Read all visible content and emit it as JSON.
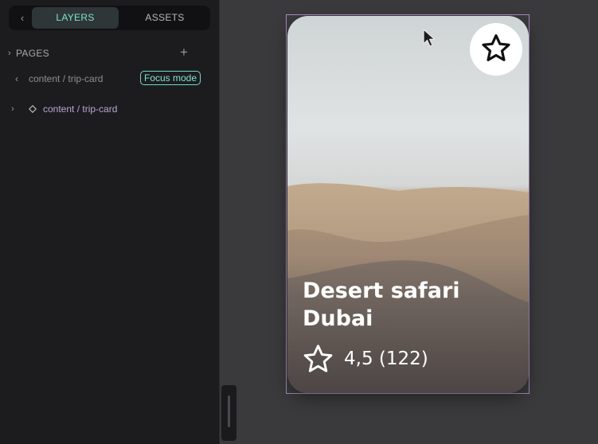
{
  "sidebar": {
    "tabs": {
      "back_glyph": "‹",
      "layers": "LAYERS",
      "assets": "ASSETS"
    },
    "pages": {
      "chevron": "›",
      "label": "PAGES",
      "add_glyph": "+"
    },
    "focus": {
      "back_glyph": "‹",
      "path": "content / trip-card",
      "badge": "Focus mode"
    },
    "layers": [
      {
        "chevron": "›",
        "icon": "diamond-component-icon",
        "name": "content / trip-card"
      }
    ]
  },
  "card": {
    "title_line1": "Desert safari",
    "title_line2": "Dubai",
    "rating": "4,5 (122)",
    "favorite_icon": "star-outline-icon",
    "rating_icon": "star-outline-icon"
  },
  "colors": {
    "accent_teal": "#7fe3d6",
    "component_purple": "#b9a4d6",
    "selection_border": "#a78bc0",
    "sidebar_bg": "#1c1c1e",
    "canvas_bg": "#3a3a3c"
  }
}
